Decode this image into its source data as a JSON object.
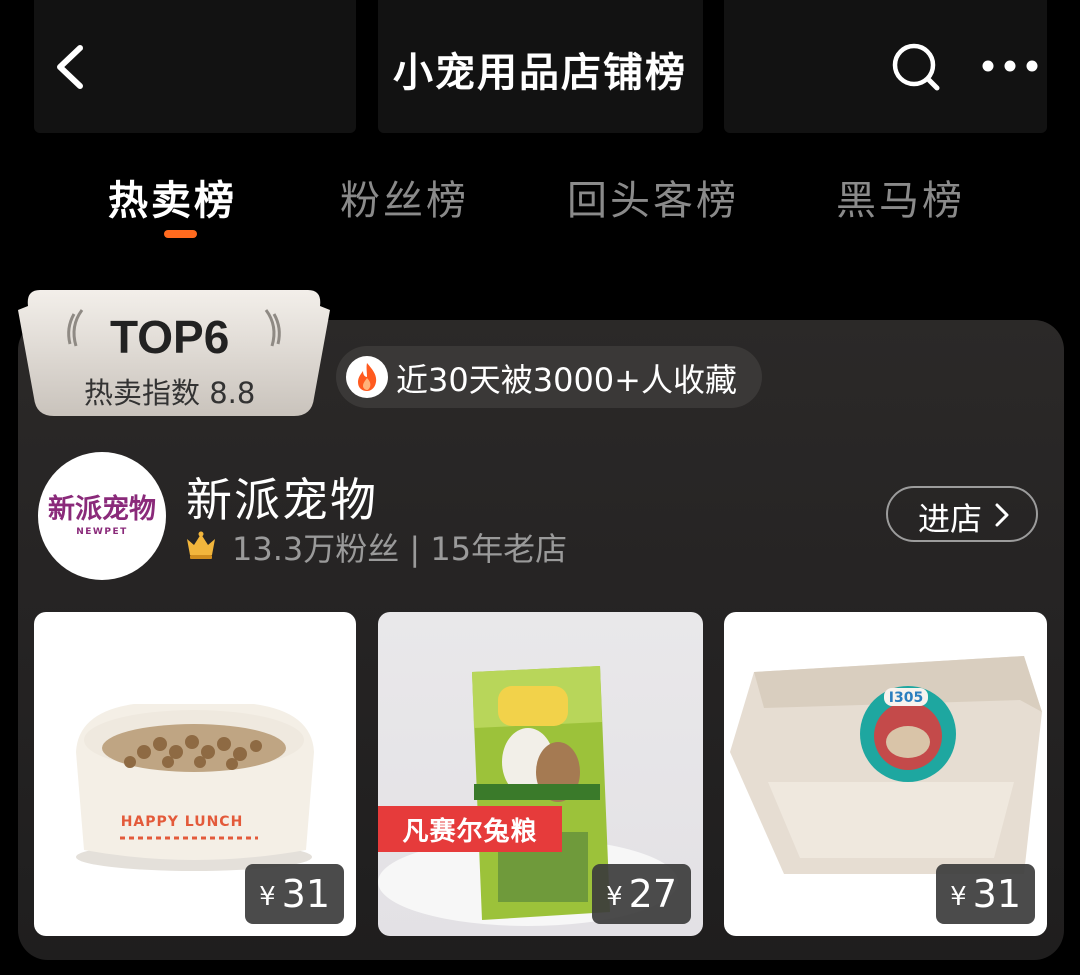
{
  "header": {
    "title": "小宠用品店铺榜"
  },
  "tabs": [
    {
      "label": "热卖榜",
      "active": true
    },
    {
      "label": "粉丝榜",
      "active": false
    },
    {
      "label": "回头客榜",
      "active": false
    },
    {
      "label": "黑马榜",
      "active": false
    }
  ],
  "rank": {
    "title": "TOP6",
    "index": "热卖指数 8.8",
    "favorites": "近30天被3000+人收藏"
  },
  "store": {
    "name": "新派宠物",
    "logo_text": "新派宠物",
    "logo_subtext": "NEWPET",
    "meta": "13.3万粉丝 | 15年老店",
    "enter_label": "进店"
  },
  "products": [
    {
      "name": "food-bowl",
      "price_symbol": "¥",
      "price": "31",
      "tag": "",
      "print_text": "HAPPY LUNCH"
    },
    {
      "name": "rabbit-food",
      "price_symbol": "¥",
      "price": "27",
      "tag": "凡赛尔兔粮"
    },
    {
      "name": "litter-box",
      "price_symbol": "¥",
      "price": "31",
      "tag": "",
      "sticker_text": "I305"
    }
  ],
  "colors": {
    "accent": "#ff6a1e",
    "tag_red": "#e63b3b"
  }
}
